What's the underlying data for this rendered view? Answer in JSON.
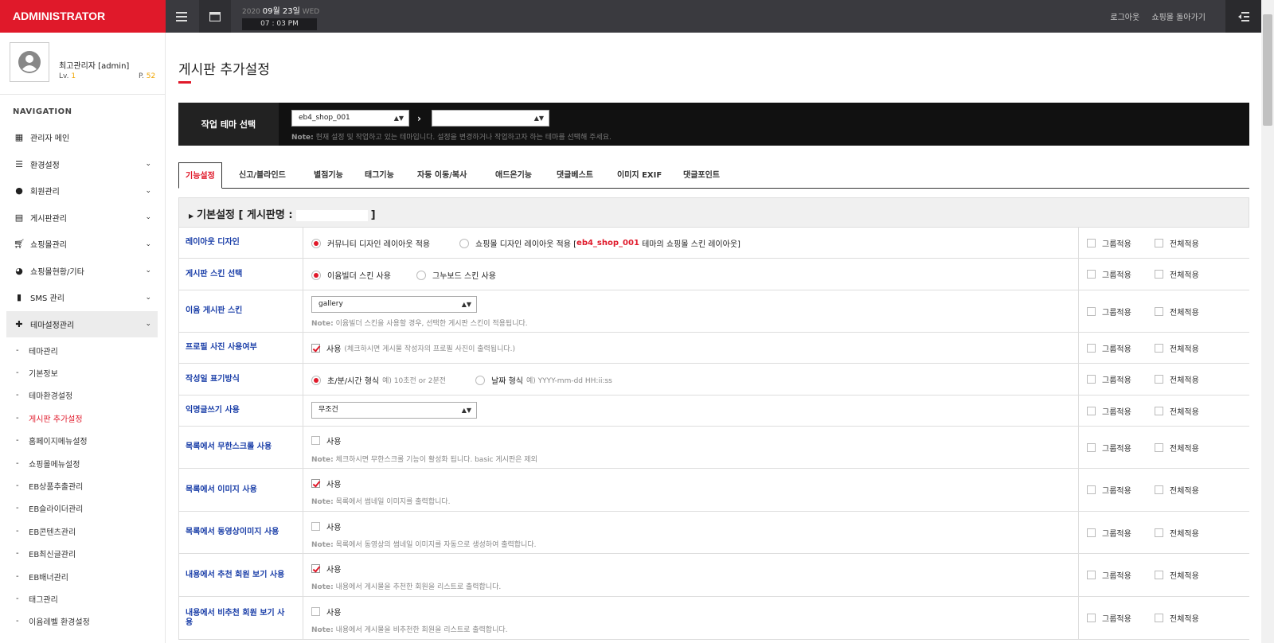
{
  "header": {
    "brand": "ADMINISTRATOR",
    "year": "2020",
    "month_day": "09월 23일",
    "weekday": "WED",
    "time": "07 : 03 PM",
    "logout": "로그아웃",
    "back_to_shop": "쇼핑몰 돌아가기"
  },
  "profile": {
    "name": "최고관리자 [admin]",
    "level_label": "Lv.",
    "level": "1",
    "point_label": "P.",
    "point": "52"
  },
  "nav": {
    "title": "NAVIGATION",
    "items": [
      {
        "label": "관리자 메인",
        "icon": "grid-icon"
      },
      {
        "label": "환경설정",
        "icon": "sliders-icon"
      },
      {
        "label": "회원관리",
        "icon": "user-icon"
      },
      {
        "label": "게시판관리",
        "icon": "list-icon"
      },
      {
        "label": "쇼핑몰관리",
        "icon": "cart-icon"
      },
      {
        "label": "쇼핑몰현황/기타",
        "icon": "pie-chart-icon"
      },
      {
        "label": "SMS 관리",
        "icon": "mobile-icon"
      },
      {
        "label": "테마설정관리",
        "icon": "puzzle-icon"
      }
    ],
    "sub_items": [
      "테마관리",
      "기본정보",
      "테마환경설정",
      "게시판 추가설정",
      "홈페이지메뉴설정",
      "쇼핑몰메뉴설정",
      "EB상품추출관리",
      "EB슬라이더관리",
      "EB콘텐츠관리",
      "EB최신글관리",
      "EB배너관리",
      "태그관리",
      "이윰레벨 환경설정"
    ]
  },
  "page": {
    "title": "게시판 추가설정",
    "theme_label": "작업 테마 선택",
    "theme_select": "eb4_shop_001",
    "theme_select2": "",
    "note_label": "Note:",
    "theme_note": "현재 설정 및 작업하고 있는 테마입니다. 설정을 변경하거나 작업하고자 하는 테마를 선택해 주세요."
  },
  "tabs": [
    "기능설정",
    "신고/블라인드",
    "별점기능",
    "태그기능",
    "자동 이동/복사",
    "애드온기능",
    "댓글베스트",
    "이미지 EXIF",
    "댓글포인트"
  ],
  "section": {
    "title": "기본설정 [ 게시판명 :",
    "close": "]"
  },
  "group_apply": "그룹적용",
  "all_apply": "전체적용",
  "rows": {
    "layout": {
      "label": "레이아웃 디자인",
      "opt1": "커뮤니티 디자인 레이아웃 적용",
      "opt2_prefix": "쇼핑몰 디자인 레이아웃 적용 [",
      "opt2_theme": "eb4_shop_001",
      "opt2_suffix": "테마의 쇼핑몰 스킨 레이아웃]"
    },
    "skin": {
      "label": "게시판 스킨 선택",
      "opt1": "이윰빌더 스킨 사용",
      "opt2": "그누보드 스킨 사용"
    },
    "eyoom_skin": {
      "label": "이윰 게시판 스킨",
      "select": "gallery",
      "note": "이윰빌더 스킨을 사용할 경우, 선택한 게시판 스킨이 적용됩니다."
    },
    "profile_photo": {
      "label": "프로필 사진 사용여부",
      "opt": "사용",
      "hint": "(체크하시면 게시물 작성자의 프로필 사진이 출력됩니다.)"
    },
    "date_format": {
      "label": "작성일 표기방식",
      "opt1": "초/분/시간 형식",
      "hint1": "예) 10초전 or 2분전",
      "opt2": "날짜 형식",
      "hint2": "예) YYYY-mm-dd HH:ii:ss"
    },
    "anonymous": {
      "label": "익명글쓰기 사용",
      "select": "무조건"
    },
    "infinite_scroll": {
      "label": "목록에서 무한스크롤 사용",
      "opt": "사용",
      "note": "체크하시면 무한스크롤 기능이 활성화 됩니다. basic 게시판은 제외"
    },
    "list_image": {
      "label": "목록에서 이미지 사용",
      "opt": "사용",
      "note": "목록에서 썸네일 이미지를 출력합니다."
    },
    "list_video": {
      "label": "목록에서 동영상이미지 사용",
      "opt": "사용",
      "note": "목록에서 동영상의 썸네일 이미지를 자동으로 생성하여 출력합니다."
    },
    "recommend": {
      "label": "내용에서 추천 회원 보기 사용",
      "opt": "사용",
      "note": "내용에서 게시물을 추천한 회원을 리스트로 출력합니다."
    },
    "nonrecommend": {
      "label": "내용에서 비추천 회원 보기 사용",
      "opt": "사용",
      "note": "내용에서 게시물을 비추천한 회원을 리스트로 출력합니다."
    }
  }
}
